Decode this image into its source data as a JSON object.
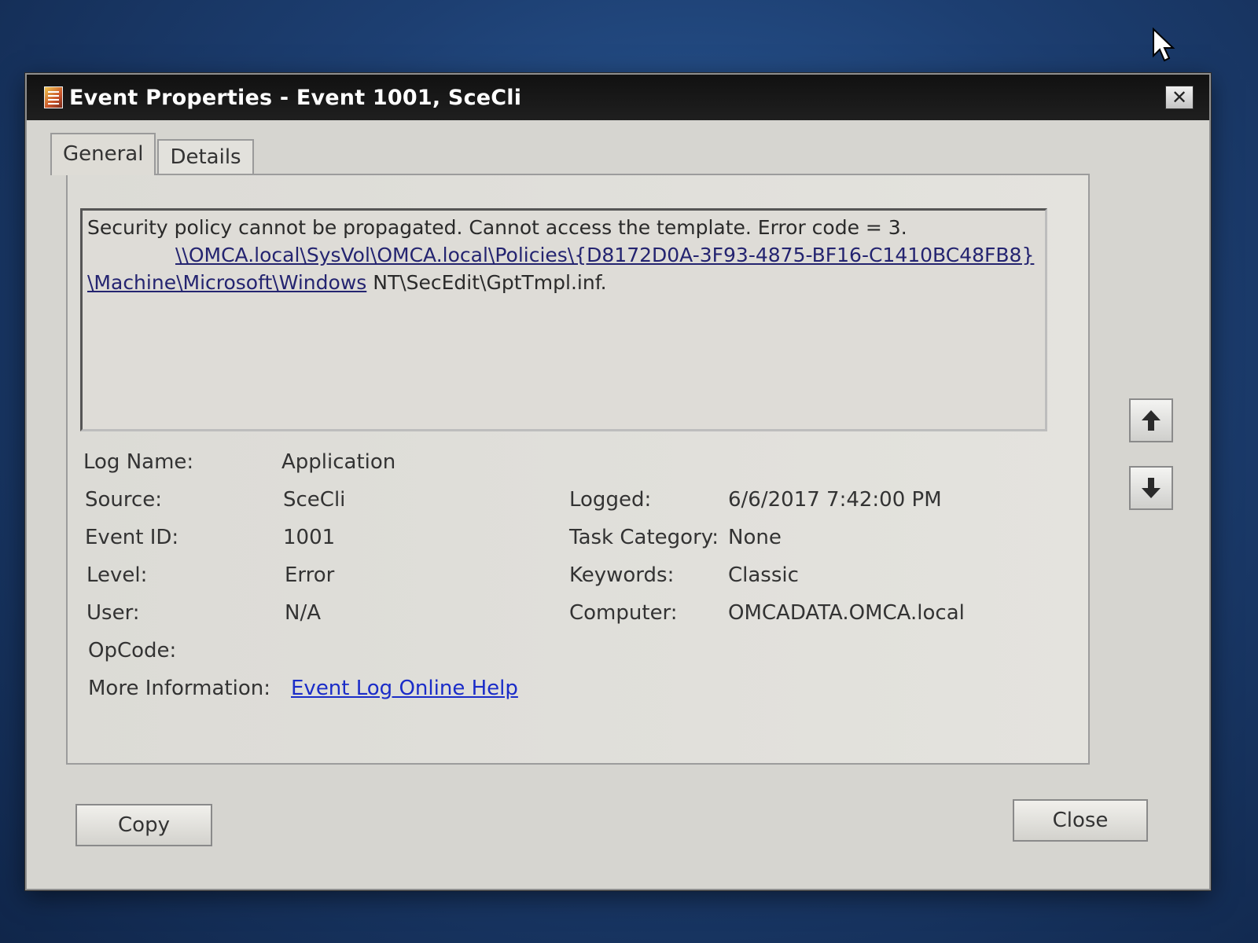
{
  "window": {
    "title": "Event Properties - Event 1001, SceCli",
    "close_glyph": "✕"
  },
  "tabs": [
    {
      "label": "General",
      "active": true
    },
    {
      "label": "Details",
      "active": false
    }
  ],
  "description": {
    "line1": "Security policy cannot be propagated. Cannot access the template. Error code = 3.",
    "line2_link": "\\\\OMCA.local\\SysVol\\OMCA.local\\Policies\\{D8172D0A-3F93-4875-BF16-C1410BC48FB8}",
    "line3_link": "\\Machine\\Microsoft\\Windows",
    "line3_rest": " NT\\SecEdit\\GptTmpl.inf."
  },
  "fields": {
    "log_name": {
      "label": "Log Name:",
      "value": "Application"
    },
    "source": {
      "label": "Source:",
      "value": "SceCli"
    },
    "logged": {
      "label": "Logged:",
      "value": "6/6/2017 7:42:00 PM"
    },
    "event_id": {
      "label": "Event ID:",
      "value": "1001"
    },
    "task_category": {
      "label": "Task Category:",
      "value": "None"
    },
    "level": {
      "label": "Level:",
      "value": "Error"
    },
    "keywords": {
      "label": "Keywords:",
      "value": "Classic"
    },
    "user": {
      "label": "User:",
      "value": "N/A"
    },
    "computer": {
      "label": "Computer:",
      "value": "OMCADATA.OMCA.local"
    },
    "opcode": {
      "label": "OpCode:",
      "value": ""
    },
    "more_info": {
      "label": "More Information:",
      "link": "Event Log Online Help"
    }
  },
  "buttons": {
    "copy": "Copy",
    "close": "Close"
  },
  "icons": {
    "up": "arrow-up-icon",
    "down": "arrow-down-icon",
    "cursor": "mouse-pointer-icon"
  }
}
